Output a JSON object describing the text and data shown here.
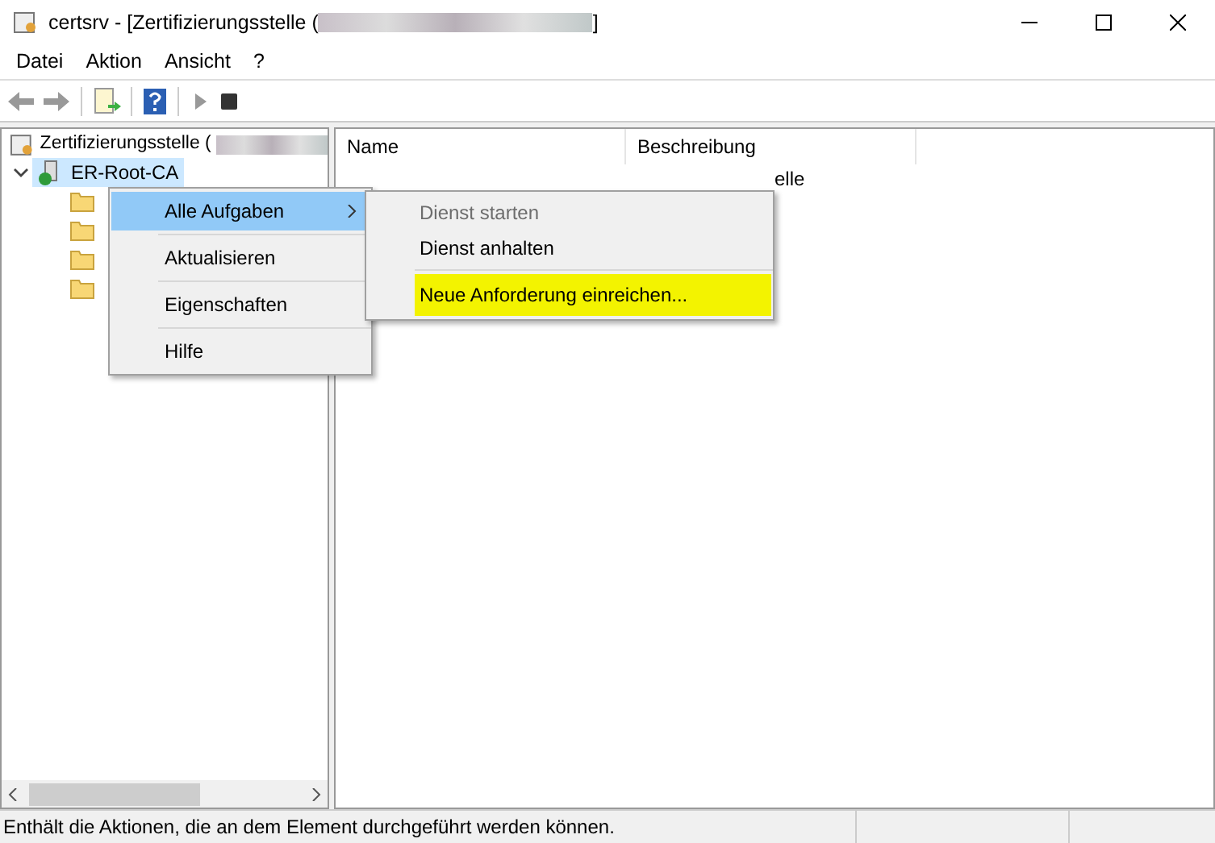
{
  "window": {
    "title_start": "certsrv - [Zertifizierungsstelle (",
    "title_end": "]"
  },
  "menu_bar": [
    "Datei",
    "Aktion",
    "Ansicht",
    "?"
  ],
  "tree": {
    "root": "Zertifizierungsstelle (",
    "ca": {
      "label": "ER-Root-CA",
      "expanded": true,
      "selected": true
    },
    "children": [
      {
        "kind": "folder"
      },
      {
        "kind": "folder"
      },
      {
        "kind": "folder"
      },
      {
        "kind": "folder"
      }
    ]
  },
  "list": {
    "columns": [
      "Name",
      "Beschreibung"
    ],
    "rows": [
      {
        "description": "elle"
      }
    ]
  },
  "context_menu": [
    {
      "label": "Alle Aufgaben",
      "selected": true,
      "submenu": true
    },
    {
      "label": "Aktualisieren",
      "selected": false,
      "submenu": false
    },
    {
      "label": "Eigenschaften",
      "selected": false,
      "submenu": false
    },
    {
      "label": "Hilfe",
      "selected": false,
      "submenu": false
    }
  ],
  "submenu": [
    {
      "label": "Dienst starten",
      "disabled": true,
      "highlighted": false
    },
    {
      "label": "Dienst anhalten",
      "disabled": false,
      "highlighted": false
    },
    {
      "label": "Neue Anforderung einreichen...",
      "disabled": false,
      "highlighted": true
    }
  ],
  "status_bar": "Enthält die Aktionen, die an dem Element durchgeführt werden können."
}
